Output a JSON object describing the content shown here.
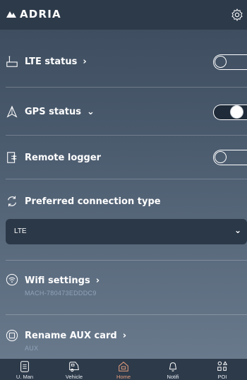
{
  "header": {
    "brand": "ADRIA",
    "settings_icon": "gear-icon"
  },
  "rows": [
    {
      "label": "LTE status",
      "chevron": "›",
      "icon": "router-icon",
      "toggle": "off"
    },
    {
      "label": "GPS status",
      "chevron": "⌄",
      "icon": "satellite-icon",
      "toggle": "on"
    },
    {
      "label": "Remote logger",
      "icon": "logger-icon",
      "toggle": "off"
    },
    {
      "label": "Preferred connection type",
      "icon": "sync-icon"
    },
    {
      "label": "Wifi settings",
      "chevron": "›",
      "sub": "MACH-780473EDDDC9",
      "icon": "wifi-icon"
    },
    {
      "label": "Rename AUX card",
      "chevron": "›",
      "sub": "AUX",
      "icon": "card-icon"
    }
  ],
  "select": {
    "value": "LTE",
    "chevron": "⌄"
  },
  "nav": [
    {
      "label": "U. Man",
      "icon": "manual-icon"
    },
    {
      "label": "Vehicle",
      "icon": "vehicle-icon"
    },
    {
      "label": "Home",
      "icon": "home-icon",
      "active": true
    },
    {
      "label": "Notifi",
      "icon": "bell-icon"
    },
    {
      "label": "POI",
      "icon": "poi-icon"
    }
  ],
  "colors": {
    "accent": "#e9a07e",
    "header_bg": "#2d3a4a",
    "subtext": "#8fa3b8"
  }
}
